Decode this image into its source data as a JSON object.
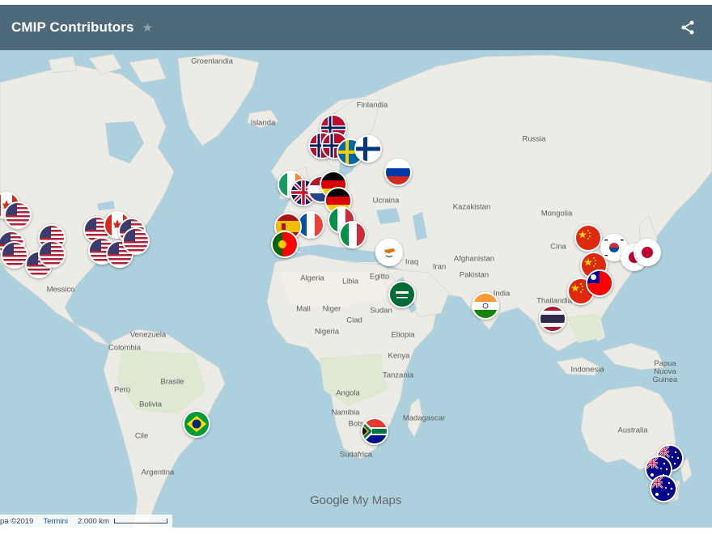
{
  "header": {
    "title": "CMIP Contributors",
    "star_icon": "star-icon",
    "share_icon": "share-icon"
  },
  "map": {
    "labels": [
      {
        "key": "groenlandia",
        "text": "Groenlandia"
      },
      {
        "key": "islanda",
        "text": "Islanda"
      },
      {
        "key": "finlandia",
        "text": "Finlandia"
      },
      {
        "key": "russia",
        "text": "Russia"
      },
      {
        "key": "ucraina",
        "text": "Ucraina"
      },
      {
        "key": "kazakistan",
        "text": "Kazakistan"
      },
      {
        "key": "mongolia",
        "text": "Mongolia"
      },
      {
        "key": "cina",
        "text": "Cina"
      },
      {
        "key": "iraq",
        "text": "Iraq"
      },
      {
        "key": "iran",
        "text": "Iran"
      },
      {
        "key": "afghanistan",
        "text": "Afghanistan"
      },
      {
        "key": "pakistan",
        "text": "Pakistan"
      },
      {
        "key": "india",
        "text": "India"
      },
      {
        "key": "thailandia",
        "text": "Thailandia"
      },
      {
        "key": "indonesia",
        "text": "Indonesia"
      },
      {
        "key": "papua",
        "text": "Papua Nuova Guinea"
      },
      {
        "key": "australia",
        "text": "Australia"
      },
      {
        "key": "algeria",
        "text": "Algeria"
      },
      {
        "key": "libia",
        "text": "Libia"
      },
      {
        "key": "egitto",
        "text": "Egitto"
      },
      {
        "key": "mali",
        "text": "Mali"
      },
      {
        "key": "niger",
        "text": "Niger"
      },
      {
        "key": "ciad",
        "text": "Ciad"
      },
      {
        "key": "sudan",
        "text": "Sudan"
      },
      {
        "key": "nigeria",
        "text": "Nigeria"
      },
      {
        "key": "etiopia",
        "text": "Etiopia"
      },
      {
        "key": "kenya",
        "text": "Kenya"
      },
      {
        "key": "tanzania",
        "text": "Tanzania"
      },
      {
        "key": "angola",
        "text": "Angola"
      },
      {
        "key": "namibia",
        "text": "Namibia"
      },
      {
        "key": "botswana",
        "text": "Bots"
      },
      {
        "key": "madagascar",
        "text": "Madagascar"
      },
      {
        "key": "sudafrica",
        "text": "Sudafrica"
      },
      {
        "key": "messico",
        "text": "Messico"
      },
      {
        "key": "venezuela",
        "text": "Venezuela"
      },
      {
        "key": "colombia",
        "text": "Colombia"
      },
      {
        "key": "peru",
        "text": "Perù"
      },
      {
        "key": "brasile",
        "text": "Brasile"
      },
      {
        "key": "bolivia",
        "text": "Bolivia"
      },
      {
        "key": "cile",
        "text": "Cile"
      },
      {
        "key": "argentina",
        "text": "Argentina"
      }
    ],
    "markers": [
      {
        "country": "canada",
        "flag": "ca"
      },
      {
        "country": "usa",
        "flag": "us"
      },
      {
        "country": "usa",
        "flag": "us"
      },
      {
        "country": "usa",
        "flag": "us"
      },
      {
        "country": "usa",
        "flag": "us"
      },
      {
        "country": "usa",
        "flag": "us"
      },
      {
        "country": "usa",
        "flag": "us"
      },
      {
        "country": "usa",
        "flag": "us"
      },
      {
        "country": "usa",
        "flag": "us"
      },
      {
        "country": "usa",
        "flag": "us"
      },
      {
        "country": "canada",
        "flag": "ca"
      },
      {
        "country": "usa",
        "flag": "us"
      },
      {
        "country": "usa",
        "flag": "us"
      },
      {
        "country": "brazil",
        "flag": "br"
      },
      {
        "country": "norway",
        "flag": "no"
      },
      {
        "country": "norway",
        "flag": "no"
      },
      {
        "country": "norway",
        "flag": "no"
      },
      {
        "country": "sweden",
        "flag": "se"
      },
      {
        "country": "finland",
        "flag": "fi"
      },
      {
        "country": "russia",
        "flag": "ru"
      },
      {
        "country": "ireland",
        "flag": "ie"
      },
      {
        "country": "uk",
        "flag": "gb"
      },
      {
        "country": "netherlands",
        "flag": "nl"
      },
      {
        "country": "germany",
        "flag": "de"
      },
      {
        "country": "germany",
        "flag": "de"
      },
      {
        "country": "france",
        "flag": "fr"
      },
      {
        "country": "italy",
        "flag": "it"
      },
      {
        "country": "spain",
        "flag": "es"
      },
      {
        "country": "portugal",
        "flag": "pt"
      },
      {
        "country": "italy",
        "flag": "it"
      },
      {
        "country": "cyprus",
        "flag": "cy"
      },
      {
        "country": "saudi-arabia",
        "flag": "sa"
      },
      {
        "country": "india",
        "flag": "in"
      },
      {
        "country": "thailand",
        "flag": "th"
      },
      {
        "country": "china",
        "flag": "cn"
      },
      {
        "country": "china",
        "flag": "cn"
      },
      {
        "country": "china",
        "flag": "cn"
      },
      {
        "country": "south-korea",
        "flag": "kr"
      },
      {
        "country": "japan",
        "flag": "jp"
      },
      {
        "country": "japan",
        "flag": "jp"
      },
      {
        "country": "taiwan",
        "flag": "tw"
      },
      {
        "country": "south-africa",
        "flag": "za"
      },
      {
        "country": "australia",
        "flag": "au"
      },
      {
        "country": "australia",
        "flag": "au"
      },
      {
        "country": "australia",
        "flag": "au"
      }
    ]
  },
  "brand": {
    "google": "Google",
    "mymaps": "My Maps"
  },
  "footer": {
    "attribution": "pa ©2019",
    "terms": "Termini",
    "scale": "2.000 km"
  },
  "colors": {
    "header": "#4e6a7a",
    "ocean": "#acd0dd",
    "land": "#ecebe6"
  }
}
